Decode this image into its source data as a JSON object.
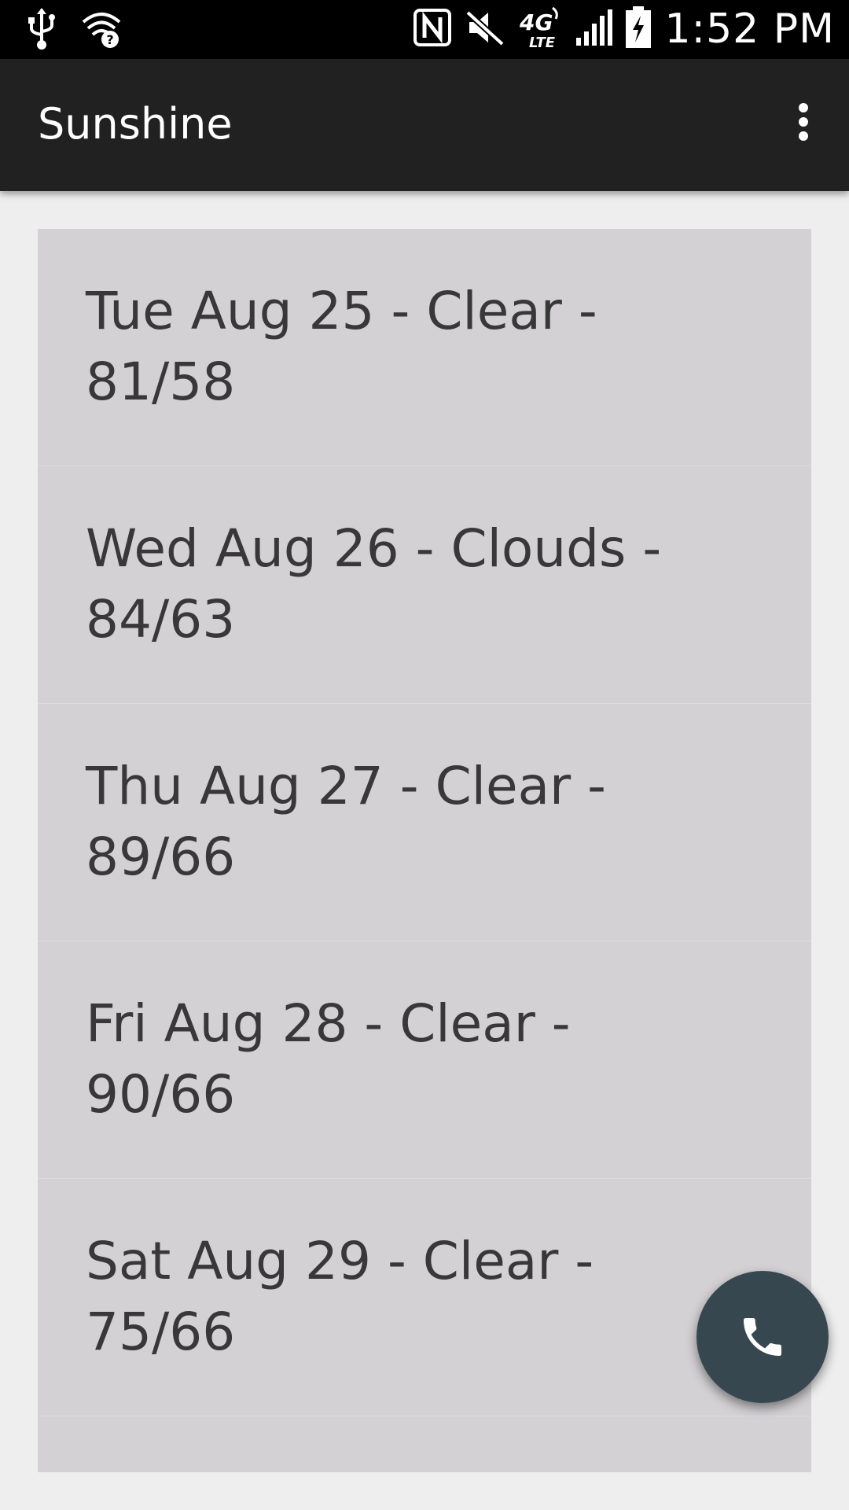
{
  "status_bar": {
    "time": "1:52 PM",
    "icons": [
      "usb-icon",
      "wifi-question-icon",
      "nfc-icon",
      "mute-icon",
      "4g-lte-icon",
      "signal-icon",
      "battery-charging-icon"
    ]
  },
  "app_bar": {
    "title": "Sunshine",
    "overflow_icon": "more-vert-icon",
    "background": "#212121"
  },
  "forecast": {
    "items": [
      {
        "label": "Tue Aug 25 - Clear - 81/58"
      },
      {
        "label": "Wed Aug 26 - Clouds - 84/63"
      },
      {
        "label": "Thu Aug 27 - Clear - 89/66"
      },
      {
        "label": "Fri Aug 28 - Clear - 90/66"
      },
      {
        "label": "Sat Aug 29 - Clear - 75/66"
      }
    ]
  },
  "fab": {
    "icon": "phone-icon",
    "color": "#37474f"
  }
}
